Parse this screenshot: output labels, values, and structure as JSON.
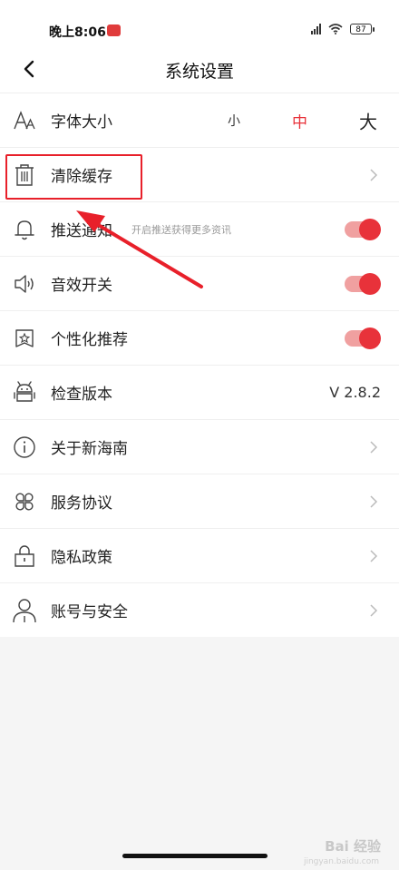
{
  "status_bar": {
    "time": "晚上8:06",
    "battery": "87"
  },
  "header": {
    "title": "系统设置"
  },
  "settings": {
    "font_size": {
      "label": "字体大小",
      "options": [
        "小",
        "中",
        "大"
      ],
      "selected": "中"
    },
    "clear_cache": {
      "label": "清除缓存"
    },
    "push": {
      "label": "推送通知",
      "sub": "开启推送获得更多资讯",
      "enabled": true
    },
    "sound": {
      "label": "音效开关",
      "enabled": true
    },
    "personalized": {
      "label": "个性化推荐",
      "enabled": true
    },
    "version": {
      "label": "检查版本",
      "value": "V 2.8.2"
    },
    "about": {
      "label": "关于新海南"
    },
    "agreement": {
      "label": "服务协议"
    },
    "privacy": {
      "label": "隐私政策"
    },
    "account": {
      "label": "账号与安全"
    }
  },
  "colors": {
    "accent": "#e8323a",
    "annotation": "#e8202a"
  },
  "watermark": {
    "text": "Bai 经验",
    "sub": "jingyan.baidu.com"
  }
}
